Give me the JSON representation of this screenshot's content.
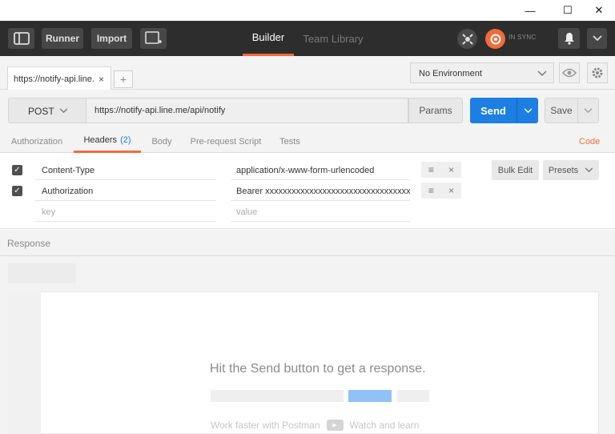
{
  "window": {
    "minimize_glyph": "—",
    "maximize_glyph": "☐",
    "close_glyph": "✕"
  },
  "header": {
    "runner_label": "Runner",
    "import_label": "Import",
    "tabs": [
      {
        "label": "Builder",
        "active": true
      },
      {
        "label": "Team Library",
        "active": false
      }
    ],
    "sync_status": "IN SYNC",
    "accent_color": "#f26b3a"
  },
  "request_tab": {
    "label": "https://notify-api.line.",
    "close_glyph": "×",
    "add_glyph": "+"
  },
  "environment": {
    "selected": "No Environment"
  },
  "request": {
    "method": "POST",
    "url": "https://notify-api.line.me/api/notify",
    "params_label": "Params",
    "send_label": "Send",
    "save_label": "Save"
  },
  "sub_tabs": {
    "authorization": "Authorization",
    "headers": "Headers",
    "headers_count": "(2)",
    "body": "Body",
    "prerequest": "Pre-request Script",
    "tests": "Tests",
    "code": "Code"
  },
  "headers": {
    "rows": [
      {
        "key": "Content-Type",
        "value": "application/x-www-form-urlencoded",
        "checked": true
      },
      {
        "key": "Authorization",
        "value": "Bearer xxxxxxxxxxxxxxxxxxxxxxxxxxxxxxxxxxx",
        "checked": true
      }
    ],
    "key_placeholder": "key",
    "value_placeholder": "value",
    "bulk_edit_label": "Bulk Edit",
    "presets_label": "Presets",
    "check_glyph": "✓",
    "menu_glyph": "≡",
    "remove_glyph": "×"
  },
  "response": {
    "label": "Response",
    "hint": "Hit the Send button to get a response.",
    "promo_left": "Work faster with Postman",
    "promo_right": "Watch and learn"
  }
}
